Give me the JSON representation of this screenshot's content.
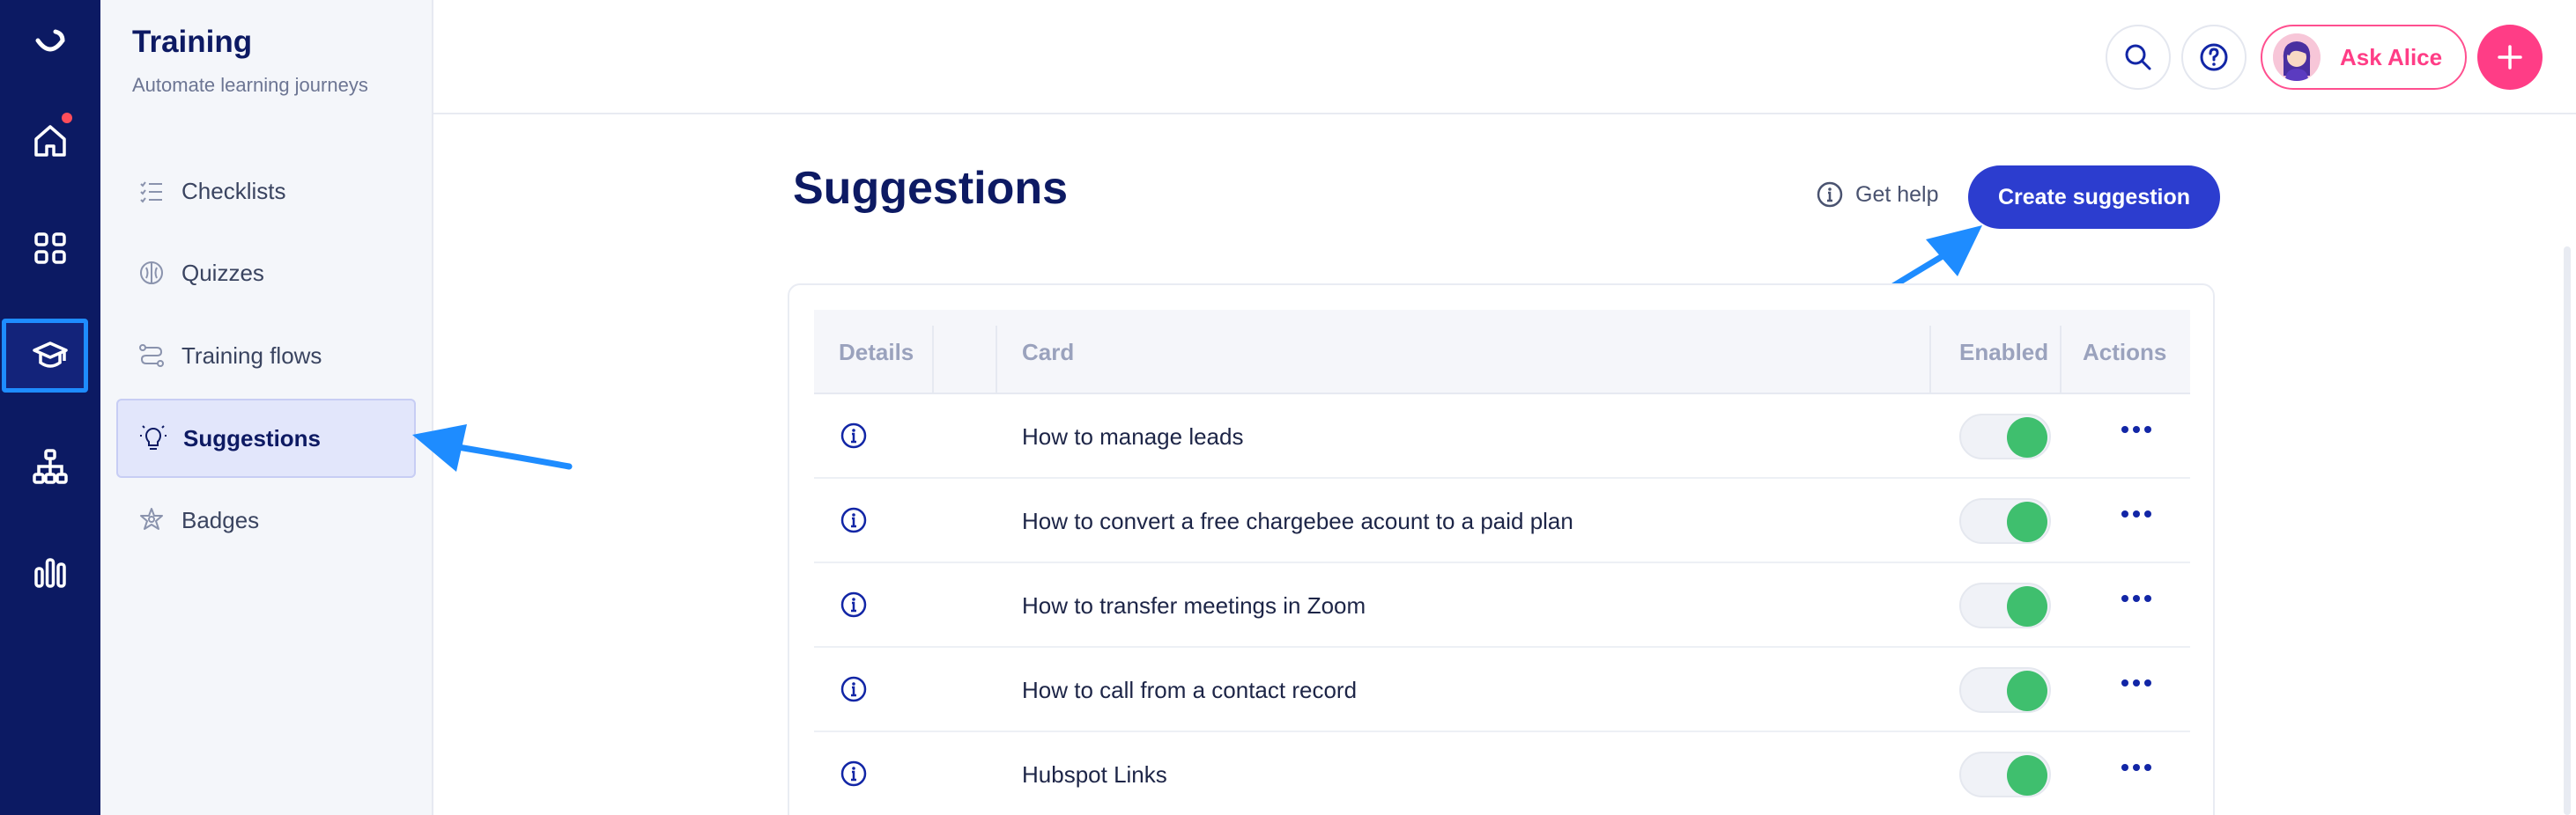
{
  "sidebar": {
    "title": "Training",
    "subtitle": "Automate learning journeys",
    "items": [
      {
        "label": "Checklists",
        "icon": "checklist-icon"
      },
      {
        "label": "Quizzes",
        "icon": "brain-icon"
      },
      {
        "label": "Training flows",
        "icon": "flow-icon"
      },
      {
        "label": "Suggestions",
        "icon": "lightbulb-icon",
        "active": true
      },
      {
        "label": "Badges",
        "icon": "badge-icon"
      }
    ]
  },
  "rail": {
    "items": [
      "logo-icon",
      "home-icon",
      "apps-icon",
      "graduation-cap-icon",
      "org-chart-icon",
      "analytics-icon"
    ],
    "active": "graduation-cap-icon"
  },
  "topbar": {
    "ask_label": "Ask Alice"
  },
  "main": {
    "title": "Suggestions",
    "help_label": "Get help",
    "create_label": "Create suggestion"
  },
  "table": {
    "headers": {
      "details": "Details",
      "card": "Card",
      "enabled": "Enabled",
      "actions": "Actions"
    },
    "rows": [
      {
        "card": "How to manage leads",
        "enabled": true
      },
      {
        "card": "How to convert a free chargebee acount to a paid plan",
        "enabled": true
      },
      {
        "card": "How to transfer meetings in Zoom",
        "enabled": true
      },
      {
        "card": "How to call from a contact record",
        "enabled": true
      },
      {
        "card": "Hubspot Links",
        "enabled": true
      }
    ]
  },
  "colors": {
    "rail_bg": "#0c1a63",
    "accent": "#2c3dcf",
    "brand_pink": "#ff3d86",
    "toggle_on": "#3fbf6e",
    "annotation_arrow": "#1e8cff"
  }
}
